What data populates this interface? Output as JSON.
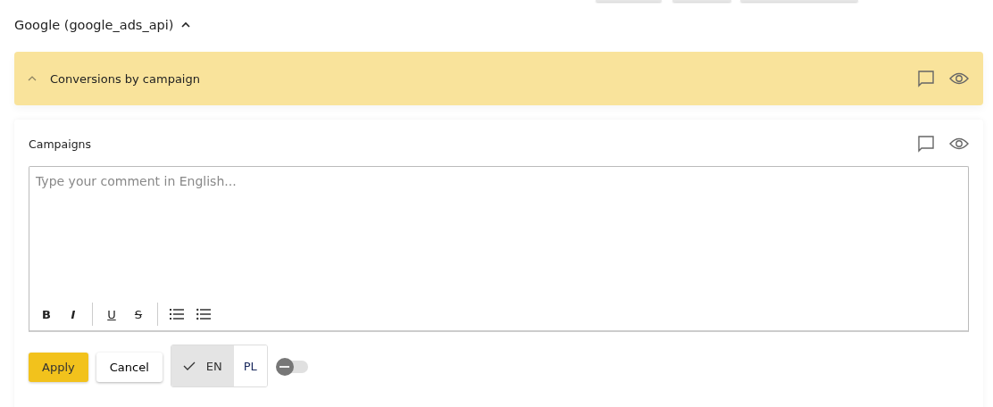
{
  "source": {
    "title": "Google (google_ads_api)",
    "expanded": true
  },
  "section": {
    "title": "Conversions by campaign",
    "expanded": true
  },
  "card": {
    "title": "Campaigns"
  },
  "editor": {
    "placeholder": "Type your comment in English...",
    "toolbar": [
      {
        "kind": "bold",
        "label": "B"
      },
      {
        "kind": "italic",
        "label": "I"
      },
      {
        "kind": "sep"
      },
      {
        "kind": "underline",
        "label": "U"
      },
      {
        "kind": "strike",
        "label": "S"
      },
      {
        "kind": "sep"
      },
      {
        "kind": "ol"
      },
      {
        "kind": "ul"
      }
    ]
  },
  "buttons": {
    "apply": "Apply",
    "cancel": "Cancel"
  },
  "languages": [
    {
      "label": "EN",
      "selected": true
    },
    {
      "label": "PL",
      "selected": false
    }
  ],
  "toggle": {
    "on": false
  }
}
